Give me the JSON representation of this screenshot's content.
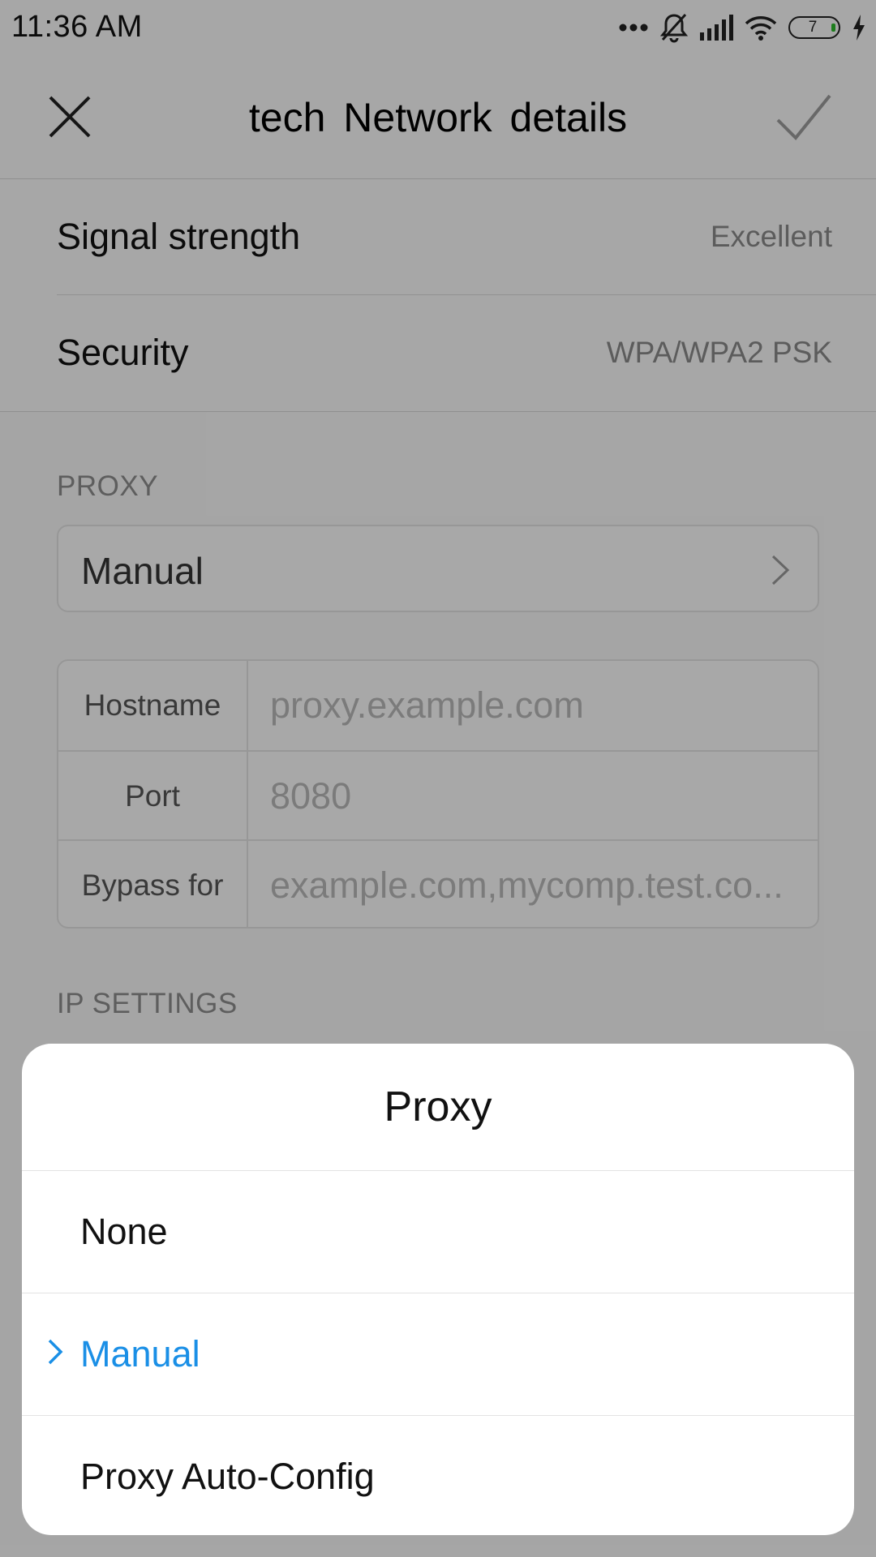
{
  "status_bar": {
    "time": "11:36 AM",
    "battery_level": "7",
    "icons": [
      "more-dots-icon",
      "bell-off-icon",
      "signal-icon",
      "wifi-icon",
      "battery-icon",
      "charging-icon"
    ]
  },
  "header": {
    "title": "tech  Network  details",
    "close_icon": "close-icon",
    "confirm_icon": "check-icon"
  },
  "info": {
    "signal_label": "Signal strength",
    "signal_value": "Excellent",
    "security_label": "Security",
    "security_value": "WPA/WPA2 PSK"
  },
  "proxy": {
    "section_label": "PROXY",
    "selected": "Manual",
    "hostname_label": "Hostname",
    "hostname_placeholder": "proxy.example.com",
    "port_label": "Port",
    "port_placeholder": "8080",
    "bypass_label": "Bypass for",
    "bypass_placeholder": "example.com,mycomp.test.co..."
  },
  "ip_settings": {
    "section_label": "IP SETTINGS"
  },
  "dialog": {
    "title": "Proxy",
    "options": [
      {
        "label": "None",
        "selected": false
      },
      {
        "label": "Manual",
        "selected": true
      },
      {
        "label": "Proxy Auto-Config",
        "selected": false
      }
    ],
    "accent_color": "#1a8fe6"
  }
}
